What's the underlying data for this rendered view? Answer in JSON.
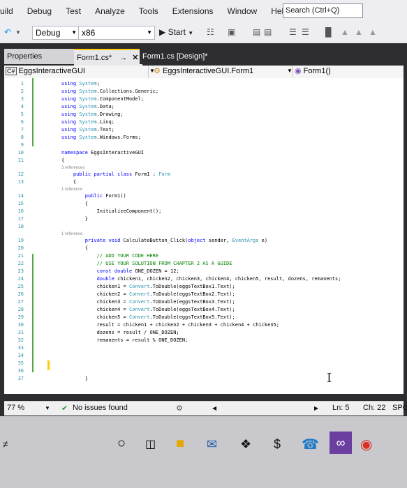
{
  "menu": {
    "items": [
      "uild",
      "Debug",
      "Test",
      "Analyze",
      "Tools",
      "Extensions",
      "Window",
      "Help"
    ],
    "search_placeholder": "Search (Ctrl+Q)"
  },
  "toolbar": {
    "config": "Debug",
    "platform": "x86",
    "start": "Start"
  },
  "tabs": {
    "properties": "Properties",
    "code_tab": "Form1.cs*",
    "design_tab": "Form1.cs [Design]*"
  },
  "navbar": {
    "project": "EggsInteractiveGUI",
    "class": "EggsInteractiveGUI.Form1",
    "member": "Form1()"
  },
  "editor": {
    "lines": [
      {
        "n": "1",
        "t": "using System;"
      },
      {
        "n": "2",
        "t": "using System.Collections.Generic;"
      },
      {
        "n": "3",
        "t": "using System.ComponentModel;"
      },
      {
        "n": "4",
        "t": "using System.Data;"
      },
      {
        "n": "5",
        "t": "using System.Drawing;"
      },
      {
        "n": "6",
        "t": "using System.Linq;"
      },
      {
        "n": "7",
        "t": "using System.Text;"
      },
      {
        "n": "8",
        "t": "using System.Windows.Forms;"
      },
      {
        "n": "9",
        "t": ""
      },
      {
        "n": "10",
        "t": "namespace EggsInteractiveGUI"
      },
      {
        "n": "11",
        "t": "{"
      },
      {
        "n": "",
        "t": "3 references",
        "ref": true
      },
      {
        "n": "12",
        "t": "    public partial class Form1 : Form"
      },
      {
        "n": "13",
        "t": "    {"
      },
      {
        "n": "",
        "t": "1 reference",
        "ref": true
      },
      {
        "n": "14",
        "t": "        public Form1()"
      },
      {
        "n": "15",
        "t": "        {"
      },
      {
        "n": "16",
        "t": "            InitializeComponent();"
      },
      {
        "n": "17",
        "t": "        }"
      },
      {
        "n": "18",
        "t": ""
      },
      {
        "n": "",
        "t": "1 reference",
        "ref": true
      },
      {
        "n": "19",
        "t": "        private void CalculateButton_Click(object sender, EventArgs e)"
      },
      {
        "n": "20",
        "t": "        {"
      },
      {
        "n": "21",
        "t": "            // ADD YOUR CODE HERE"
      },
      {
        "n": "22",
        "t": "            // USE YOUR SOLUTION FROM CHAPTER 2 AS A GUIDE"
      },
      {
        "n": "23",
        "t": "            const double ONE_DOZEN = 12;"
      },
      {
        "n": "24",
        "t": "            double chicken1, chicken2, chicken3, chicken4, chicken5, result, dozens, remanents;"
      },
      {
        "n": "25",
        "t": "            chicken1 = Convert.ToDouble(eggsTextBox1.Text);"
      },
      {
        "n": "26",
        "t": "            chicken2 = Convert.ToDouble(eggsTextBox2.Text);"
      },
      {
        "n": "27",
        "t": "            chicken3 = Convert.ToDouble(eggsTextBox3.Text);"
      },
      {
        "n": "28",
        "t": "            chicken4 = Convert.ToDouble(eggsTextBox4.Text);"
      },
      {
        "n": "29",
        "t": "            chicken5 = Convert.ToDouble(eggsTextBox5.Text);"
      },
      {
        "n": "30",
        "t": "            result = chicken1 + chicken2 + chicken3 + chicken4 + chicken5;"
      },
      {
        "n": "31",
        "t": "            dozens = result / ONE_DOZEN;"
      },
      {
        "n": "32",
        "t": "            remanents = result % ONE_DOZEN;"
      },
      {
        "n": "33",
        "t": ""
      },
      {
        "n": "34",
        "t": ""
      },
      {
        "n": "35",
        "t": ""
      },
      {
        "n": "36",
        "t": ""
      },
      {
        "n": "37",
        "t": "        }"
      }
    ]
  },
  "status": {
    "zoom": "77 %",
    "issues": "No issues found",
    "ln": "Ln: 5",
    "ch": "Ch: 22",
    "mode": "SPC"
  }
}
